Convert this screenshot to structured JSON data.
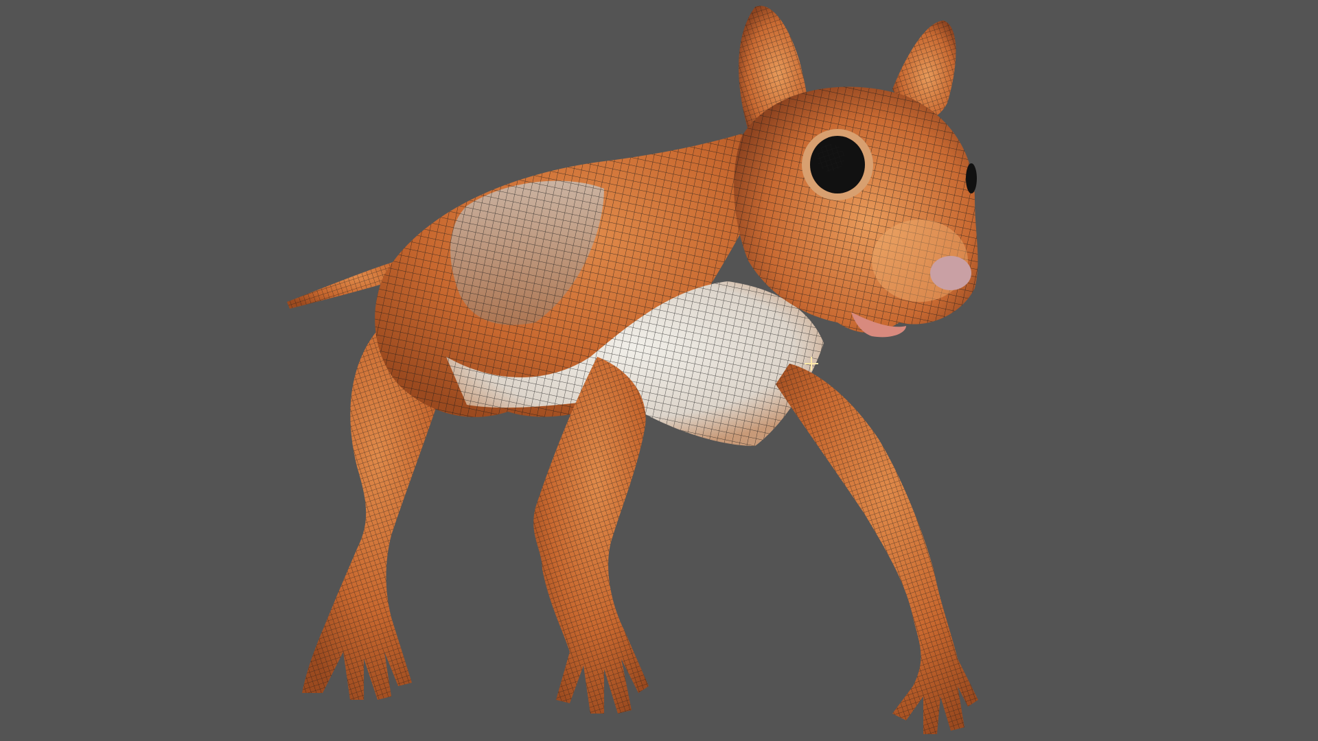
{
  "viewport": {
    "background_color": "#545454",
    "model": {
      "subject": "squirrel",
      "display": "wireframe-on-shaded",
      "fur_color": "#c8682f",
      "belly_color": "#e6e2dc",
      "wire_color": "#1a1a1a",
      "nose_color": "#c9a0a4",
      "eye_color": "#111111"
    },
    "cursor": {
      "icon": "crosshair-icon",
      "color": "#ffe9a8"
    }
  }
}
